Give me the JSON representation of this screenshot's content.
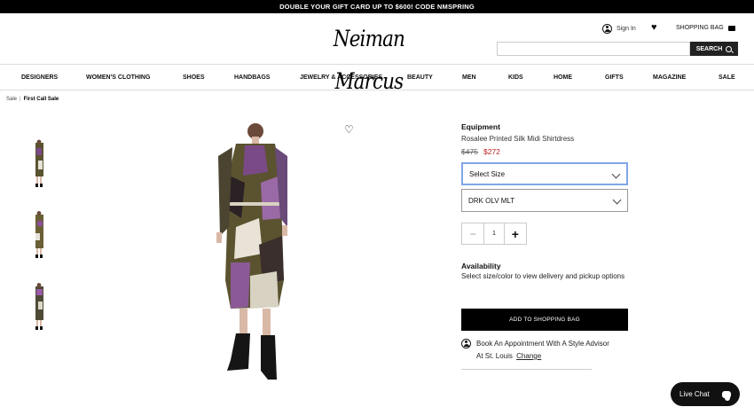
{
  "promo": "DOUBLE YOUR GIFT CARD UP TO $600! CODE NMSPRING",
  "header": {
    "logo": "Neiman Marcus",
    "sign_in": "Sign In",
    "shopping_bag": "SHOPPING BAG",
    "search_placeholder": "",
    "search_button": "SEARCH"
  },
  "nav": [
    "DESIGNERS",
    "WOMEN'S CLOTHING",
    "SHOES",
    "HANDBAGS",
    "JEWELRY & ACCESSORIES",
    "BEAUTY",
    "MEN",
    "KIDS",
    "HOME",
    "GIFTS",
    "MAGAZINE",
    "SALE"
  ],
  "breadcrumb": {
    "item1": "Sale",
    "sep": "|",
    "item2": "First Call Sale"
  },
  "product": {
    "brand": "Equipment",
    "name": "Rosalee Printed Silk Midi Shirtdress",
    "price_original": "$475",
    "price_sale": "$272",
    "size_select": "Select Size",
    "color_select": "DRK OLV MLT",
    "quantity": "1",
    "availability_heading": "Availability",
    "availability_text": "Select size/color to view delivery and pickup options",
    "add_to_bag": "ADD TO SHOPPING BAG",
    "appointment_line1": "Book An Appointment With A Style Advisor",
    "appointment_line2": "At St. Louis",
    "appointment_change": "Change"
  },
  "live_chat": "Live Chat",
  "colors": {
    "accent_red": "#b22222",
    "focus_blue": "#7fa6e6",
    "black": "#000000"
  }
}
